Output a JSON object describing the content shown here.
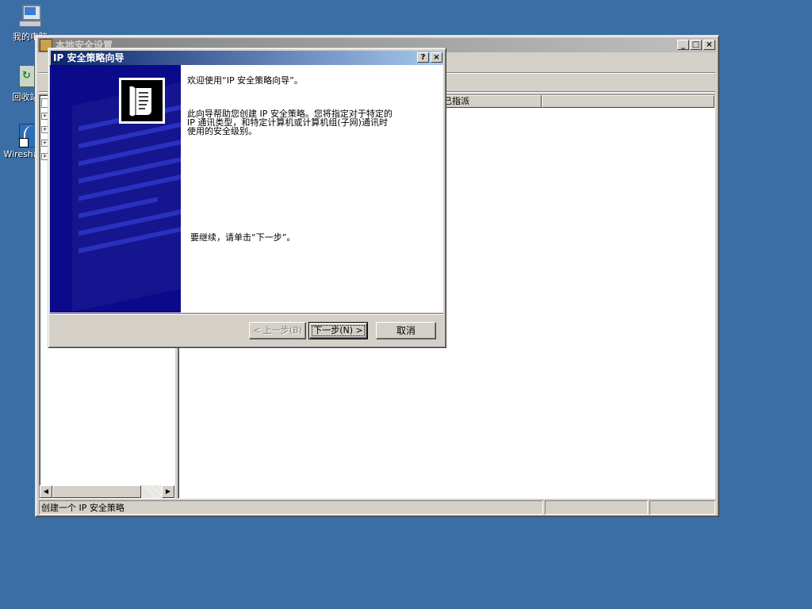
{
  "desktop": {
    "icons": [
      {
        "label": "我的电脑",
        "icon": "my-computer-icon"
      },
      {
        "label": "回收站",
        "icon": "recycle-bin-icon"
      },
      {
        "label": "Wireshark",
        "icon": "wireshark-shortcut-icon"
      }
    ]
  },
  "mmc": {
    "title": "本地安全设置",
    "column_header": "已指派",
    "status_text": "创建一个 IP 安全策略",
    "title_buttons": {
      "minimize": "_",
      "maximize": "□",
      "close": "×"
    }
  },
  "wizard": {
    "title": "IP 安全策略向导",
    "help_button": "?",
    "close_button": "×",
    "welcome": "欢迎使用“IP 安全策略向导”。",
    "description_line1": "此向导帮助您创建 IP 安全策略。您将指定对于特定的",
    "description_line2": "IP 通讯类型，和特定计算机或计算机组(子网)通讯时",
    "description_line3": "使用的安全级别。",
    "continue_text": "要继续，请单击“下一步”。",
    "back_button": "< 上一步(B)",
    "next_button": "下一步(N) >",
    "cancel_button": "取消",
    "colors": {
      "banner": "#0b0a8a",
      "banner_stripe": "#1a1fb5"
    }
  }
}
